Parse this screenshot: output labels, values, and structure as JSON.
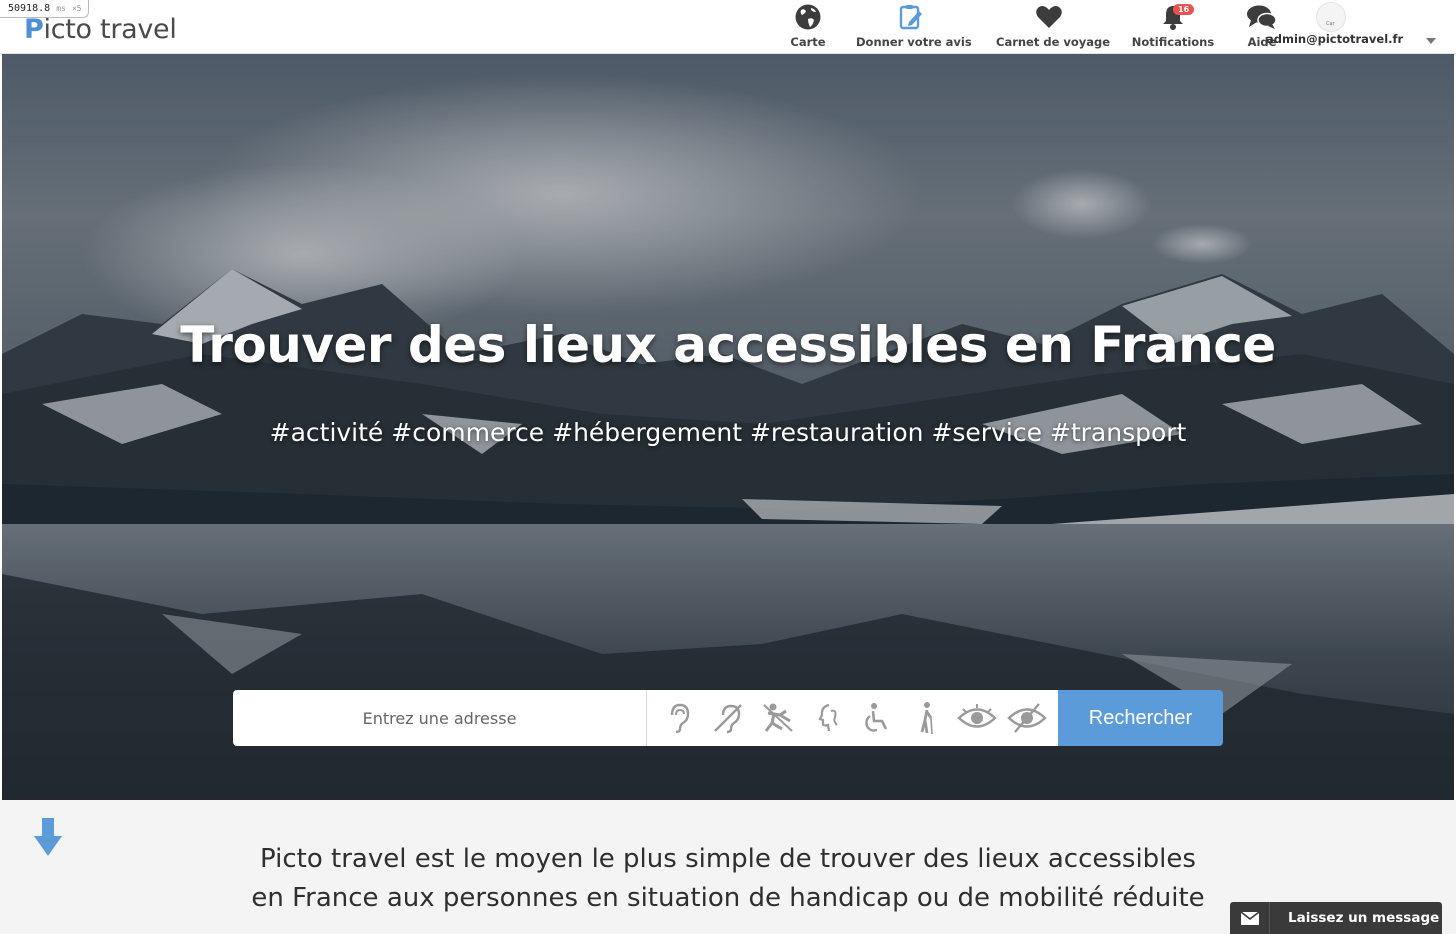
{
  "perf": {
    "value": "50918.8",
    "unit": "ms",
    "mult": "×5"
  },
  "header": {
    "logo_p": "P",
    "logo_rest": "icto travel",
    "nav": [
      {
        "label": "Carte",
        "icon": "globe-icon"
      },
      {
        "label": "Donner votre avis",
        "icon": "clipboard-edit-icon"
      },
      {
        "label": "Carnet de voyage",
        "icon": "heart-icon"
      },
      {
        "label": "Notifications",
        "icon": "bell-icon",
        "badge": "16"
      },
      {
        "label": "Aide",
        "icon": "chat-bubbles-icon"
      }
    ],
    "user": {
      "email": "admin@pictotravel.fr",
      "avatar_text": "Car"
    }
  },
  "hero": {
    "title": "Trouver des lieux accessibles en France",
    "tags": "#activité #commerce #hébergement #restauration #service #transport",
    "search": {
      "placeholder": "Entrez une adresse",
      "button": "Rechercher",
      "filters": [
        "ear-icon",
        "hearing-aid-icon",
        "mental-disability-icon",
        "cognitive-disability-icon",
        "wheelchair-icon",
        "reduced-mobility-icon",
        "low-vision-icon",
        "blind-icon"
      ]
    }
  },
  "intro": {
    "line1": "Picto travel est le moyen le plus simple de trouver des lieux accessibles",
    "line2": "en France aux personnes en situation de handicap ou de mobilité réduite"
  },
  "chat": {
    "label": "Laissez un message",
    "icon": "envelope-icon"
  },
  "colors": {
    "accent": "#5b9bd9",
    "badge": "#e9534f",
    "chat_bg": "#3a3a3a"
  }
}
